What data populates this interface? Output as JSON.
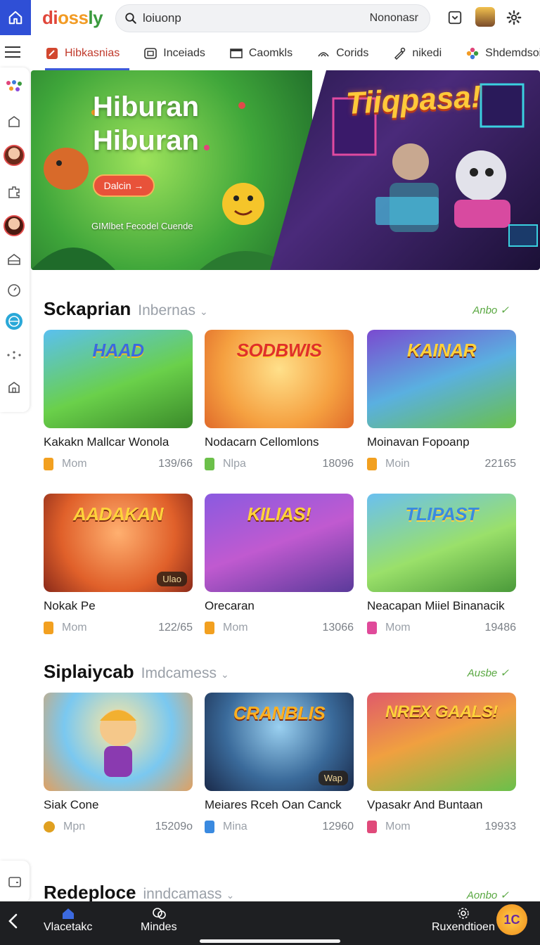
{
  "app": {
    "logo": [
      "di",
      "oss",
      "ly"
    ],
    "search": {
      "value": "loiuonp",
      "right_text": "Nononasr"
    }
  },
  "tabs": [
    {
      "label": "Hibkasnias",
      "icon": "game-icon",
      "active": true
    },
    {
      "label": "Inceiads",
      "icon": "tv-icon",
      "active": false
    },
    {
      "label": "Caomkls",
      "icon": "film-icon",
      "active": false
    },
    {
      "label": "Corids",
      "icon": "signal-icon",
      "active": false
    },
    {
      "label": "nikedi",
      "icon": "brush-icon",
      "active": false
    },
    {
      "label": "Shdemdsois",
      "icon": "flower-icon",
      "active": false
    }
  ],
  "hero": {
    "title_line1": "Hiburan",
    "title_line2": "Hiburan",
    "cta": "Dalcin →",
    "subtitle": "GIMlbet Fecodel Cuende",
    "headline": "Tiiqpasa!"
  },
  "sections": [
    {
      "title": "Sckaprian",
      "tag": "Inbernas",
      "more": "Anbo ✓",
      "cards": [
        {
          "art": "HAAD",
          "title": "Kakakn Mallcar Wonola",
          "meta": "Mom",
          "count": "139/66",
          "cube": "#f2a020",
          "badge": ""
        },
        {
          "art": "SODBWIS",
          "title": "Nodacarn Cellomlons",
          "meta": "Nlpa",
          "count": "18096",
          "cube": "#6cc04a",
          "badge": ""
        },
        {
          "art": "KAINAR",
          "title": "Moinavan Fopoanp",
          "meta": "Moin",
          "count": "22165",
          "cube": "#f2a020",
          "badge": ""
        },
        {
          "art": "AADAKAN",
          "title": "Nokak Pe",
          "meta": "Mom",
          "count": "122/65",
          "cube": "#f2a020",
          "badge": "Ulao"
        },
        {
          "art": "KILIAS!",
          "title": "Orecaran",
          "meta": "Mom",
          "count": "13066",
          "cube": "#f2a020",
          "badge": ""
        },
        {
          "art": "TLIPAST",
          "title": "Neacapan Miiel Binanacik",
          "meta": "Mom",
          "count": "19486",
          "cube": "#e04a9a",
          "badge": ""
        }
      ]
    },
    {
      "title": "Siplaiycab",
      "tag": "Imdcamess",
      "more": "Ausbe ✓",
      "cards": [
        {
          "art": "",
          "title": "Siak Cone",
          "meta": "Mpn",
          "count": "15209o",
          "cube": "#e0a020",
          "badge": ""
        },
        {
          "art": "CRANBLIS",
          "title": "Meiares Rceh Oan Canck",
          "meta": "Mina",
          "count": "12960",
          "cube": "#3a8ae0",
          "badge": "Wap"
        },
        {
          "art": "NREX GAALS!",
          "title": "Vpasakr And Buntaan",
          "meta": "Mom",
          "count": "19933",
          "cube": "#e04a7a",
          "badge": ""
        }
      ]
    },
    {
      "title": "Redeploce",
      "tag": "inndcamass",
      "more": "Aonbo ✓"
    }
  ],
  "bottom_nav": {
    "items": [
      {
        "label": "Vlacetakc",
        "icon": "home-icon"
      },
      {
        "label": "Mindes",
        "icon": "chat-icon"
      },
      {
        "label": "Ruxendtioen",
        "icon": "gear-icon"
      }
    ],
    "avatar_text": "1C"
  },
  "colors": {
    "accent": "#3c5ad9",
    "active_tab": "#c0392b",
    "more_link": "#5aa842"
  }
}
